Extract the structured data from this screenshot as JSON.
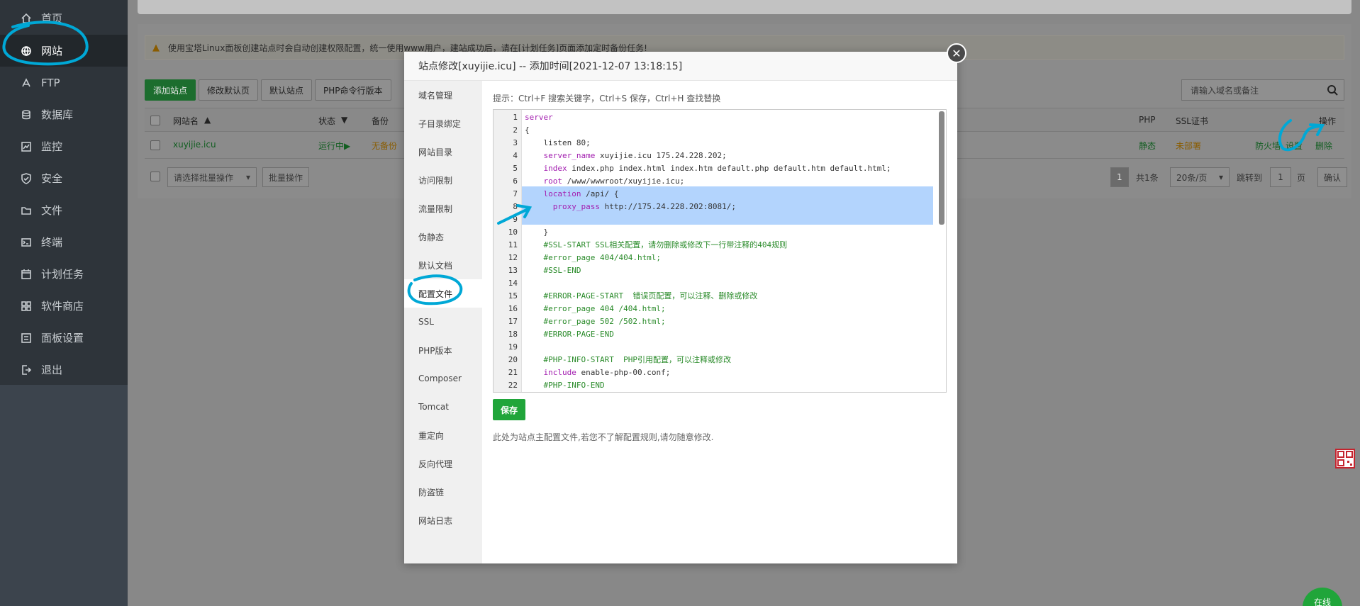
{
  "sidebar": {
    "items": [
      {
        "label": "首页",
        "icon": "home-icon"
      },
      {
        "label": "网站",
        "icon": "globe-icon",
        "active": true
      },
      {
        "label": "FTP",
        "icon": "ftp-icon"
      },
      {
        "label": "数据库",
        "icon": "database-icon"
      },
      {
        "label": "监控",
        "icon": "monitor-icon"
      },
      {
        "label": "安全",
        "icon": "shield-icon"
      },
      {
        "label": "文件",
        "icon": "folder-icon"
      },
      {
        "label": "终端",
        "icon": "terminal-icon"
      },
      {
        "label": "计划任务",
        "icon": "calendar-icon"
      },
      {
        "label": "软件商店",
        "icon": "grid-icon"
      },
      {
        "label": "面板设置",
        "icon": "settings-icon"
      },
      {
        "label": "退出",
        "icon": "logout-icon"
      }
    ]
  },
  "notice": "使用宝塔Linux面板创建站点时会自动创建权限配置，统一使用www用户，建站成功后，请在[计划任务]页面添加定时备份任务!",
  "toolbar": {
    "buttons": [
      "添加站点",
      "修改默认页",
      "默认站点",
      "PHP命令行版本"
    ],
    "search_placeholder": "请输入域名或备注"
  },
  "table": {
    "headers": {
      "name": "网站名",
      "status": "状态",
      "backup": "备份",
      "php": "PHP",
      "ssl": "SSL证书",
      "ops": "操作"
    },
    "row": {
      "name": "xuyijie.icu",
      "status": "运行中▶",
      "backup": "无备份",
      "php": "静态",
      "ssl": "未部署",
      "firewall": "防火墙",
      "settings": "设置",
      "delete": "删除"
    }
  },
  "footer": {
    "batch_select": "请选择批量操作",
    "batch_button": "批量操作",
    "page": "1",
    "total": "共1条",
    "per_page": "20条/页",
    "jump_label": "跳转到",
    "jump_value": "1",
    "page_suffix": "页",
    "confirm": "确认"
  },
  "modal": {
    "title": "站点修改[xuyijie.icu] -- 添加时间[2021-12-07 13:18:15]",
    "tabs": [
      "域名管理",
      "子目录绑定",
      "网站目录",
      "访问限制",
      "流量限制",
      "伪静态",
      "默认文档",
      "配置文件",
      "SSL",
      "PHP版本",
      "Composer",
      "Tomcat",
      "重定向",
      "反向代理",
      "防盗链",
      "网站日志"
    ],
    "active_tab": "配置文件",
    "hint": "提示：Ctrl+F 搜索关键字，Ctrl+S 保存，Ctrl+H 查找替换",
    "save": "保存",
    "note": "此处为站点主配置文件,若您不了解配置规则,请勿随意修改.",
    "close_glyph": "✕",
    "code": [
      {
        "n": "1",
        "t": "server"
      },
      {
        "n": "2",
        "t": "{"
      },
      {
        "n": "3",
        "t": "    listen 80;"
      },
      {
        "n": "4",
        "t": "    server_name xuyijie.icu 175.24.228.202;"
      },
      {
        "n": "5",
        "t": "    index index.php index.html index.htm default.php default.htm default.html;"
      },
      {
        "n": "6",
        "t": "    root /www/wwwroot/xuyijie.icu;"
      },
      {
        "n": "7",
        "t": "    location /api/ {"
      },
      {
        "n": "8",
        "t": "      proxy_pass http://175.24.228.202:8081/;"
      },
      {
        "n": "9",
        "t": ""
      },
      {
        "n": "10",
        "t": "    }"
      },
      {
        "n": "11",
        "t": "    #SSL-START SSL相关配置，请勿删除或修改下一行带注释的404规则"
      },
      {
        "n": "12",
        "t": "    #error_page 404/404.html;"
      },
      {
        "n": "13",
        "t": "    #SSL-END"
      },
      {
        "n": "14",
        "t": ""
      },
      {
        "n": "15",
        "t": "    #ERROR-PAGE-START  错误页配置，可以注释、删除或修改"
      },
      {
        "n": "16",
        "t": "    #error_page 404 /404.html;"
      },
      {
        "n": "17",
        "t": "    #error_page 502 /502.html;"
      },
      {
        "n": "18",
        "t": "    #ERROR-PAGE-END"
      },
      {
        "n": "19",
        "t": ""
      },
      {
        "n": "20",
        "t": "    #PHP-INFO-START  PHP引用配置，可以注释或修改"
      },
      {
        "n": "21",
        "t": "    include enable-php-00.conf;"
      },
      {
        "n": "22",
        "t": "    #PHP-INFO-END"
      }
    ]
  },
  "widgets": {
    "online": "在线"
  },
  "colors": {
    "accent_green": "#20a53a",
    "annotation": "#00a8d6",
    "selection": "#b3d4fd"
  }
}
